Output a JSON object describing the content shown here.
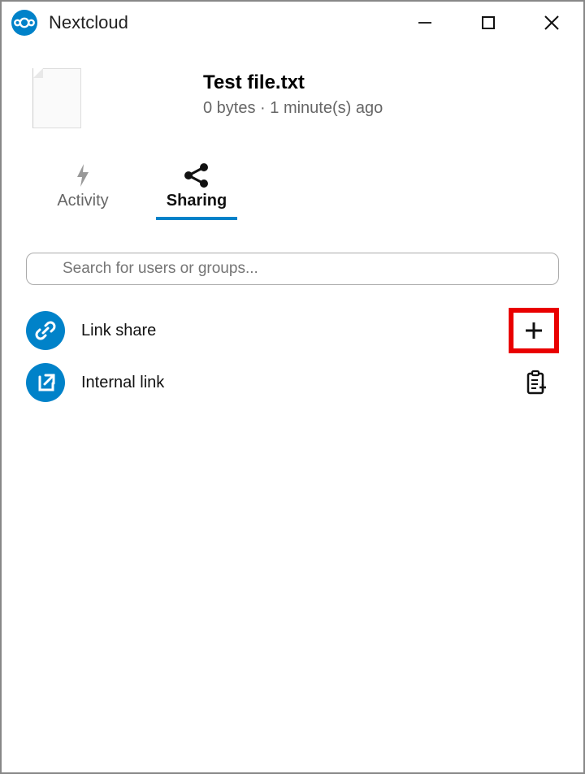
{
  "app": {
    "title": "Nextcloud"
  },
  "file": {
    "name": "Test file.txt",
    "size": "0 bytes",
    "separator": " · ",
    "time": "1 minute(s) ago"
  },
  "tabs": {
    "activity": "Activity",
    "sharing": "Sharing"
  },
  "search": {
    "placeholder": "Search for users or groups..."
  },
  "share": {
    "link": "Link share",
    "internal": "Internal link"
  }
}
